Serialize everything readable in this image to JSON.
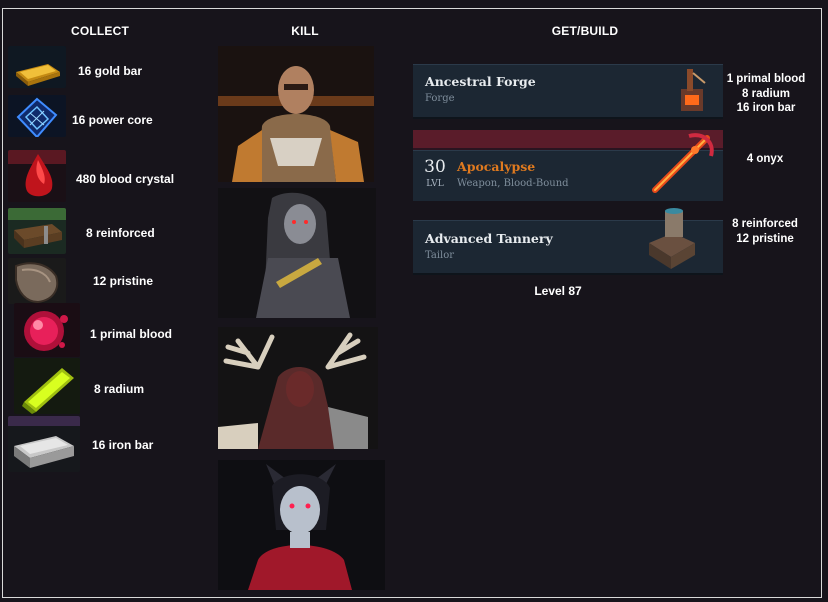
{
  "headers": {
    "collect": "COLLECT",
    "kill": "KILL",
    "get_build": "GET/BUILD"
  },
  "collect": [
    {
      "label": "16 gold bar",
      "icon": "gold-bar-icon"
    },
    {
      "label": "16 power core",
      "icon": "power-core-icon"
    },
    {
      "label": "480 blood crystal",
      "icon": "blood-crystal-icon"
    },
    {
      "label": "8 reinforced",
      "icon": "reinforced-plank-icon"
    },
    {
      "label": "12 pristine",
      "icon": "pristine-hide-icon"
    },
    {
      "label": "1 primal blood",
      "icon": "primal-blood-icon"
    },
    {
      "label": "8 radium",
      "icon": "radium-icon"
    },
    {
      "label": "16 iron bar",
      "icon": "iron-bar-icon"
    }
  ],
  "kill": [
    {
      "name": "bald-warrior-boss-portrait"
    },
    {
      "name": "grey-haired-vampire-boss-portrait"
    },
    {
      "name": "antlered-beast-boss-portrait"
    },
    {
      "name": "horned-vampire-woman-boss-portrait"
    }
  ],
  "build": {
    "forge": {
      "title": "Ancestral Forge",
      "subtitle": "Forge",
      "icon": "forge-icon"
    },
    "apocalypse": {
      "level_number": "30",
      "level_label": "LVL",
      "title": "Apocalypse",
      "subtitle": "Weapon, Blood-Bound",
      "icon": "crossbow-weapon-icon",
      "title_color": "#e07a1f"
    },
    "tannery": {
      "title": "Advanced Tannery",
      "subtitle": "Tailor",
      "icon": "tannery-icon"
    },
    "level_requirement": "Level 87"
  },
  "requirements": {
    "forge": [
      "1 primal blood",
      "8 radium",
      "16 iron bar"
    ],
    "apocalypse": [
      "4 onyx"
    ],
    "tannery": [
      "8 reinforced",
      "12 pristine"
    ]
  }
}
